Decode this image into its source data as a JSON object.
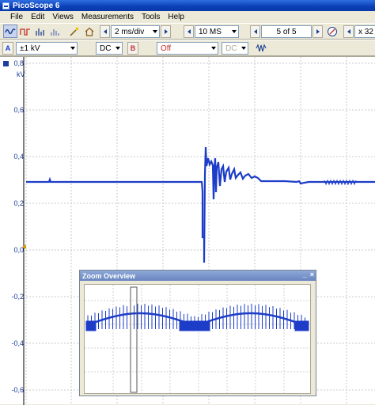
{
  "window": {
    "title": "PicoScope 6"
  },
  "menu": [
    {
      "label": "File"
    },
    {
      "label": "Edit"
    },
    {
      "label": "Views"
    },
    {
      "label": "Measurements"
    },
    {
      "label": "Tools"
    },
    {
      "label": "Help"
    }
  ],
  "toolbar": {
    "timebase": "2 ms/div",
    "samples": "10 MS",
    "buffer": "5 of 5",
    "zoom": "x 32"
  },
  "channel_a": {
    "label": "A",
    "range": "±1 kV",
    "coupling": "DC"
  },
  "channel_b": {
    "label": "B",
    "range": "Off",
    "coupling": "DC"
  },
  "scope": {
    "unit": "kV",
    "y_ticks": [
      "0,8",
      "0,6",
      "0,4",
      "0,2",
      "0,0",
      "-0,2",
      "-0,4",
      "-0,6"
    ],
    "trace_color": "#1d3dc8",
    "grid": true
  },
  "zoom_overview": {
    "title": "Zoom Overview",
    "minimize_glyph": "_",
    "close_glyph": "×"
  }
}
